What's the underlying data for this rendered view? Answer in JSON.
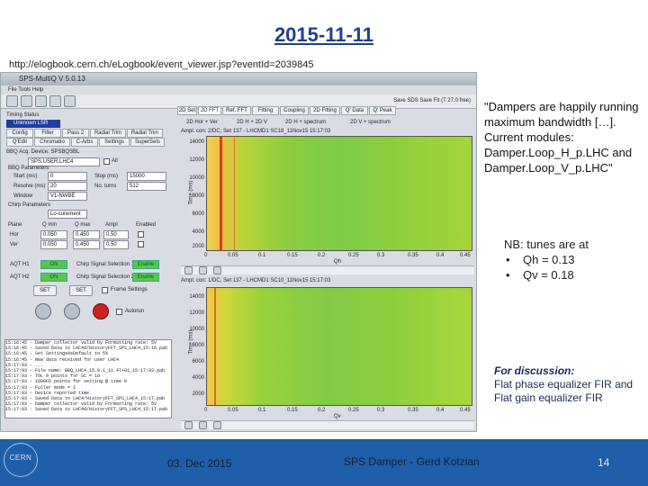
{
  "slide": {
    "title": "2015-11-11",
    "url": "http://elogbook.cern.ch/eLogbook/event_viewer.jsp?eventId=2039845",
    "quote": "\"Dampers are happily running\nmaximum bandwidth […].\nCurrent modules:\nDamper.Loop_H_p.LHC and\nDamper.Loop_V_p.LHC\"",
    "nb_title": "NB: tunes are at",
    "nb_bullets": [
      "Qh = 0.13",
      "Qv = 0.18"
    ],
    "discussion_label": "For discussion:",
    "discussion_text": "Flat phase equalizer FIR and Flat gain equalizer FIR",
    "footer": {
      "date": "03. Dec 2015",
      "center": "SPS Damper - Gerd Kotzian",
      "page": "14",
      "logo": "CERN"
    }
  },
  "app": {
    "window_title": "SPS-MultiQ V 5.0.13",
    "window_menu": "File  Tools  Help",
    "toolbar_right": "Save SDS    Save Fit (T 27.0 free)",
    "timing_label": "Timing Status",
    "timing_value": "Unknown LSR",
    "left_tabs": [
      "Config",
      "Filter",
      "Pass 2",
      "Radial Trim",
      "Radial Trim"
    ],
    "left_tabs2": [
      "Q'Edit",
      "Chromatio",
      "C-Arbs",
      "Settings",
      "SuperSets"
    ],
    "device_label": "BBQ Acq. Device: SPSBQSBL",
    "dropdown_value": "SPS.USER.LHC4",
    "all_label": "All",
    "params_label": "BBQ Parameters",
    "params": [
      {
        "label": "Start (ms)",
        "value": "0",
        "label2": "Stop (ms)",
        "value2": "15000"
      },
      {
        "label": "Resolve (ms)",
        "value": "20",
        "label2": "No. turns",
        "value2": "512"
      },
      {
        "label": "Window",
        "value": "V1-NWBE",
        "label2": "",
        "value2": ""
      }
    ],
    "chirp_label": "Chirp Parameters",
    "chirp_mode": "Lo-curement",
    "qtable_headers": [
      "Plane",
      "Q min",
      "Q max",
      "Ampl",
      "Enabled"
    ],
    "qtable_rows": [
      {
        "plane": "Hor",
        "qmin": "0.050",
        "qmax": "0.450",
        "ampl": "0.50"
      },
      {
        "plane": "Ver",
        "qmin": "0.050",
        "qmax": "0.450",
        "ampl": "0.50"
      }
    ],
    "aqt": [
      {
        "label": "AQT H1",
        "status": "ON",
        "desc": "Chirp Signal Selection 1",
        "state": "Enable"
      },
      {
        "label": "AQT H2",
        "status": "ON",
        "desc": "Chirp Signal Selection 2",
        "state": "Enable"
      }
    ],
    "set_label": "SET",
    "frame_set_label": "Frame Settings",
    "autorun_label": "Autorun",
    "right_tabs": [
      "2D Set",
      "2D FFT",
      "Ref. FFT",
      "Fitting",
      "Coupling",
      "2D Fitting",
      "Q' Data",
      "Q' Peak"
    ],
    "radio": [
      "2D Hor + Ver",
      "2D H + 2D V",
      "2D H + spectrum",
      "2D V + spectrum"
    ],
    "plot1": {
      "title": "Ampl. con: 2/DC, Set 137 - LHCMD1 SC18_11Nov15 15:17:03",
      "ylabel": "Time (ms)",
      "xlabel": "Qh",
      "yticks": [
        "14000",
        "12000",
        "10000",
        "8000",
        "6000",
        "4000",
        "2000"
      ],
      "xticks": [
        "0",
        "0.05",
        "0.1",
        "0.15",
        "0.2",
        "0.25",
        "0.3",
        "0.35",
        "0.4",
        "0.45"
      ]
    },
    "plot2": {
      "title": "Ampl. con: 1/DC, Set 137 - LHCMD1 SC10_11Nov15 15:17:03",
      "ylabel": "Time (ms)",
      "xlabel": "Qv",
      "yticks": [
        "14000",
        "12000",
        "10000",
        "8000",
        "6000",
        "4000",
        "2000"
      ],
      "xticks": [
        "0",
        "0.05",
        "0.1",
        "0.15",
        "0.2",
        "0.25",
        "0.3",
        "0.35",
        "0.4",
        "0.45"
      ]
    },
    "log_lines": [
      "15:16:45 - Damper collector valid by Formatting rate: 5V",
      "15:16:45 - Saved Data to LHC4d/HistoryFFT_SPS_LHC4_15:16.pab",
      "15:16:45 - Set SettingsAsDefault to 5%",
      "15:16:45 - New data received for user LHC4",
      "15:17:03 - ...",
      "15:17:03 - File name: BBQ_LHC4_15.0.1_11.47+01_15:17:03.pab",
      "15:17:03 - TOL 0 points for SC = 10",
      "15:17:03 - 1000FD points for setting @ time 0",
      "15:17:03 - Fuller mode = 1",
      "15:17:03 - Device reported time",
      "15:17:03 - Saved Data to LHC4/HistoryFFT_SPS_LHC4_15:17.pab",
      "15:17:03 - Damper collector valid by Formatting rate: 5V",
      "15:17:03 - Saved Data to LHC4d/HistoryFFT_SPS_LHC4_15:17.pab"
    ],
    "colors": {
      "spectrum_hot": "#e03c1c",
      "spectrum_bg": "#7ccb45",
      "spectrum_edge": "#f4d04a",
      "status_green": "#5bc44c",
      "footer_blue": "#1f5ea8"
    }
  }
}
